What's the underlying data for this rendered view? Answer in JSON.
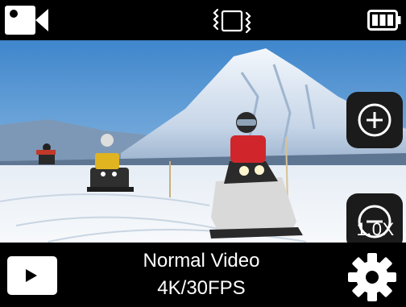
{
  "top_bar": {
    "mode_icon": "video-camera-icon",
    "stabilization_icon": "stabilization-icon",
    "battery_icon": "battery-icon"
  },
  "zoom": {
    "zoom_in_icon": "plus-circle-icon",
    "zoom_out_icon": "minus-circle-icon",
    "level": "1.0X"
  },
  "bottom_bar": {
    "playback_icon": "play-icon",
    "mode_label": "Normal Video",
    "resolution_label": "4K/30FPS",
    "settings_icon": "gear-icon"
  }
}
